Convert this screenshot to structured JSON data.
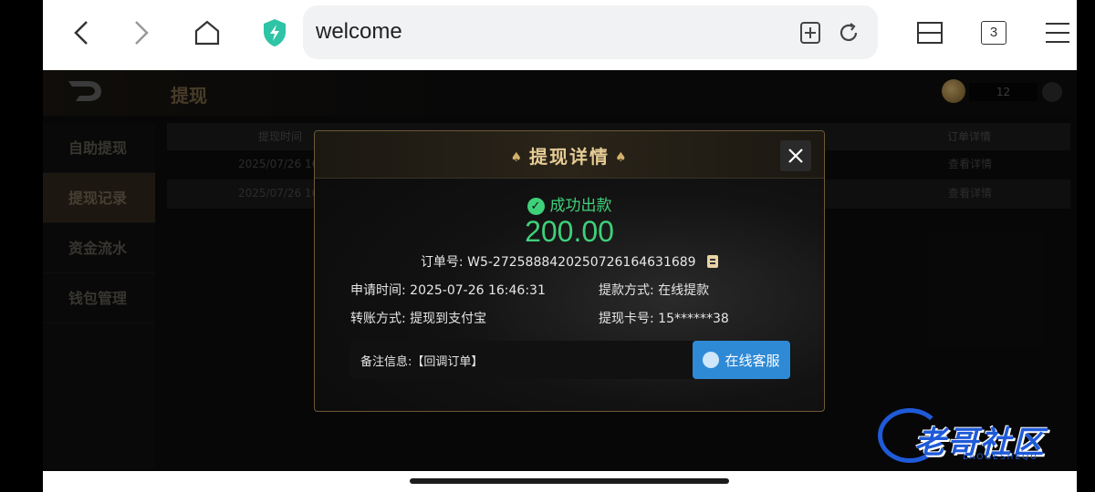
{
  "browser": {
    "url_text": "welcome",
    "tab_count": "3"
  },
  "app": {
    "title": "提现",
    "balance": "12",
    "sidebar": {
      "items": [
        {
          "label": "自助提现"
        },
        {
          "label": "提现记录"
        },
        {
          "label": "资金流水"
        },
        {
          "label": "钱包管理"
        }
      ]
    },
    "table": {
      "headers": [
        "提现时间",
        "订单详情"
      ],
      "rows": [
        {
          "time": "2025/07/26 16:4",
          "detail": "查看详情"
        },
        {
          "time": "2025/07/26 16:3",
          "detail": "查看详情"
        }
      ]
    }
  },
  "modal": {
    "title": "提现详情",
    "status": "成功出款",
    "amount": "200.00",
    "order_label": "订单号:",
    "order_no": "W5-2725888420250726164631689",
    "apply_time_label": "申请时间:",
    "apply_time": "2025-07-26 16:46:31",
    "method_label": "提款方式:",
    "method": "在线提款",
    "transfer_label": "转账方式:",
    "transfer": "提现到支付宝",
    "card_label": "提现卡号:",
    "card": "15******38",
    "remark_label": "备注信息:",
    "remark": "【回调订单】",
    "service_button": "在线客服"
  },
  "watermark": {
    "text": "老哥社区",
    "sub": "LAOGESHEQU"
  },
  "colors": {
    "success": "#3fd07a",
    "gold": "#e6cc95",
    "service_blue": "#2f8ad6"
  }
}
